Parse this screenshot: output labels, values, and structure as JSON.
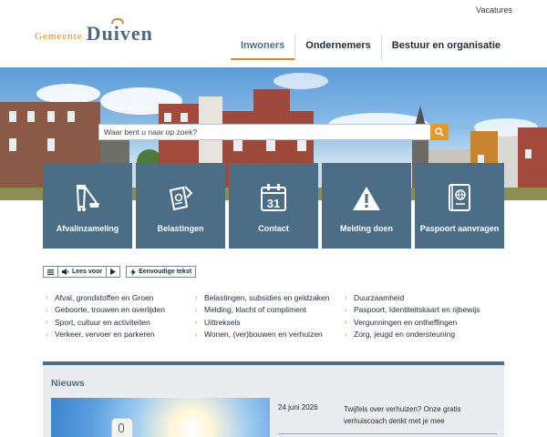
{
  "header": {
    "top_link": "Vacatures",
    "logo_prefix": "Gemeente",
    "logo_name": "Duiven",
    "nav": [
      {
        "label": "Inwoners",
        "active": true
      },
      {
        "label": "Ondernemers",
        "active": false
      },
      {
        "label": "Bestuur en organisatie",
        "active": false
      }
    ]
  },
  "search": {
    "placeholder": "Waar bent u naar op zoek?",
    "value": "",
    "button_icon": "search-icon"
  },
  "tiles": [
    {
      "label": "Afvalinzameling",
      "icon": "waste-bin-icon"
    },
    {
      "label": "Belastingen",
      "icon": "tax-document-icon"
    },
    {
      "label": "Contact",
      "icon": "calendar-31-icon"
    },
    {
      "label": "Melding doen",
      "icon": "warning-icon"
    },
    {
      "label": "Paspoort aanvragen",
      "icon": "passport-icon"
    }
  ],
  "calendar_day": "31",
  "tools": {
    "read_aloud": "Lees voor",
    "easy_text": "Eenvoudige tekst"
  },
  "links": {
    "col1": [
      "Afval, grondstoffen en Groen",
      "Geboorte, trouwen en overlijden",
      "Sport, cultuur en activiteiten",
      "Verkeer, vervoer en parkeren"
    ],
    "col2": [
      "Belastingen, subsidies en geldzaken",
      "Melding, klacht of compliment",
      "Uittreksels",
      "Wonen, (ver)bouwen en verhuizen"
    ],
    "col3": [
      "Duurzaamheid",
      "Paspoort, Identiteitskaart en rijbewijs",
      "Vergunningen en ontheffingen",
      "Zorg, jeugd en ondersteuning"
    ]
  },
  "news": {
    "heading": "Nieuws",
    "items": [
      {
        "date": "24 juni 2026",
        "title": "Twijfels over verhuizen? Onze gratis verhuiscoach denkt met je mee"
      }
    ]
  },
  "colors": {
    "accent": "#d58b2c",
    "tile": "#4b6d85",
    "search_button": "#e09a2d"
  }
}
